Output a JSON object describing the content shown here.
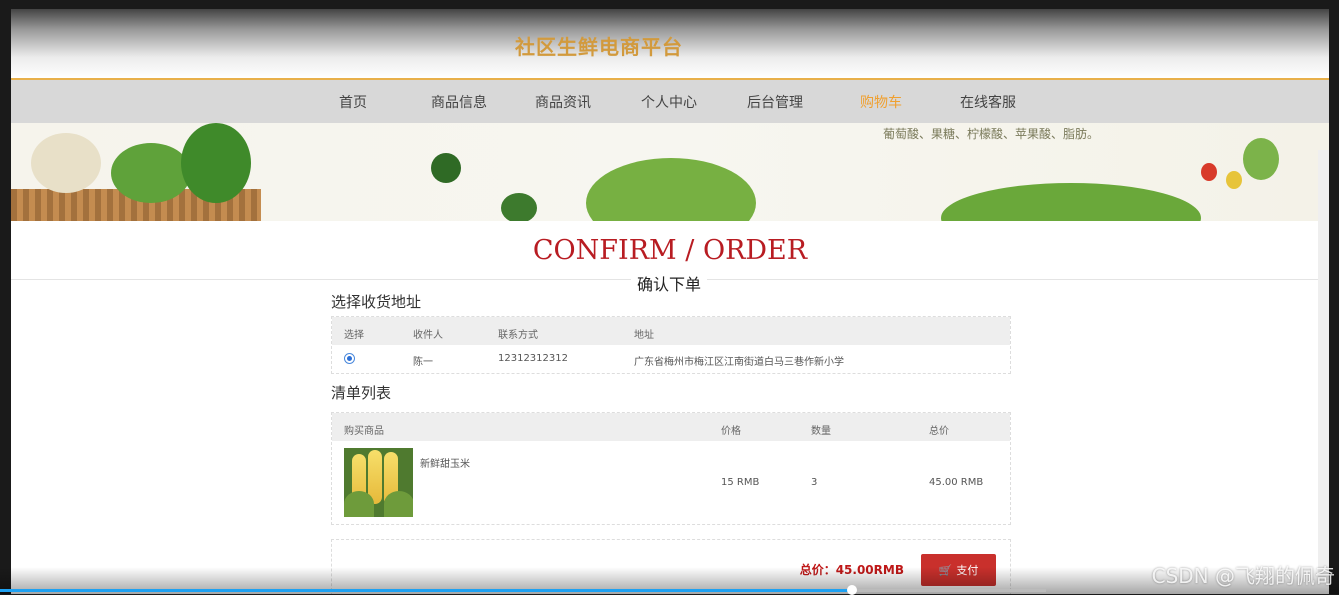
{
  "site": {
    "title": "社区生鲜电商平台"
  },
  "nav": {
    "items": [
      {
        "label": "首页"
      },
      {
        "label": "商品信息"
      },
      {
        "label": "商品资讯"
      },
      {
        "label": "个人中心"
      },
      {
        "label": "后台管理"
      },
      {
        "label": "购物车",
        "active": true
      },
      {
        "label": "在线客服"
      }
    ]
  },
  "banner": {
    "text": "葡萄酸、果糖、柠檬酸、苹果酸、脂肪。"
  },
  "page": {
    "title_en": "CONFIRM / ORDER",
    "title_cn": "确认下单"
  },
  "address": {
    "section_title": "选择收货地址",
    "headers": [
      "选择",
      "收件人",
      "联系方式",
      "地址"
    ],
    "rows": [
      {
        "selected": true,
        "name": "陈一",
        "phone": "12312312312",
        "address": "广东省梅州市梅江区江南街道白马三巷作新小学"
      }
    ]
  },
  "items": {
    "section_title": "清单列表",
    "headers": [
      "购买商品",
      "价格",
      "数量",
      "总价"
    ],
    "rows": [
      {
        "name": "新鲜甜玉米",
        "price": "15 RMB",
        "qty": "3",
        "total": "45.00 RMB"
      }
    ]
  },
  "payment": {
    "total_label": "总价：45.00RMB",
    "pay_label": "支付"
  },
  "player": {
    "progress": 0.815
  },
  "watermark": "CSDN @飞翔的佩奇",
  "colors": {
    "accent": "#f0a030",
    "brand_title": "#d29a3d",
    "order_title": "#b81c22",
    "pay_button": "#c9302c"
  }
}
